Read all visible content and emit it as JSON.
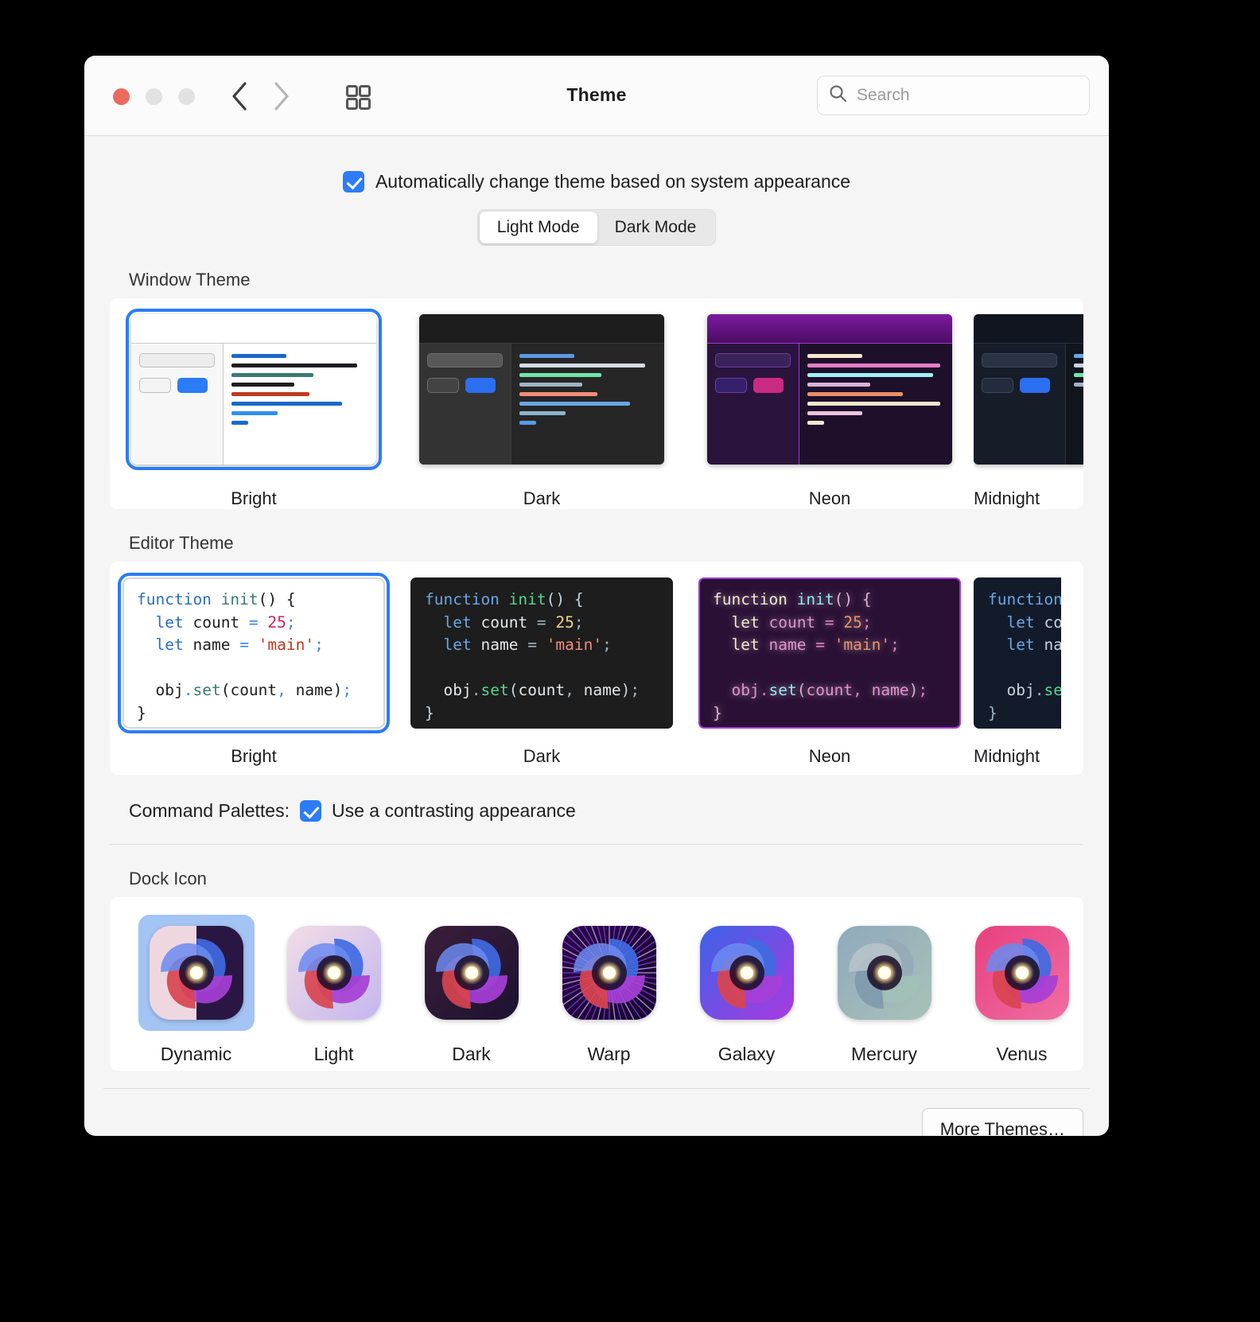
{
  "window": {
    "title": "Theme",
    "traffic_lights": [
      "close",
      "minimize",
      "zoom"
    ],
    "back_label": "Back",
    "forward_label": "Forward",
    "grid_label": "Show All",
    "accent_color": "#2b7cf6"
  },
  "search": {
    "placeholder": "Search",
    "value": ""
  },
  "auto_theme": {
    "label": "Automatically change theme based on system appearance",
    "checked": true
  },
  "appearance_segmented": {
    "options": [
      "Light Mode",
      "Dark Mode"
    ],
    "selected": "Light Mode"
  },
  "window_theme": {
    "heading": "Window Theme",
    "selected": "Bright",
    "items": [
      {
        "label": "Bright",
        "titlebar": "#ffffff",
        "sidebar": "#f7f7f7",
        "main": "#ffffff",
        "border": "#c9c9c9",
        "field_bg": "#ededed",
        "field_border": "#bdbdbd",
        "btn1_bg": "#f4f4f4",
        "btn2_bg": "#2b7cf6",
        "lines": [
          {
            "color": "#1a68c9",
            "width": "40%"
          },
          {
            "color": "#1d1d1f",
            "width": "92%"
          },
          {
            "color": "#3d7a74",
            "width": "60%"
          },
          {
            "color": "#1d1d1f",
            "width": "46%"
          },
          {
            "color": "#c03a1d",
            "width": "57%"
          },
          {
            "color": "#1a68c9",
            "width": "81%"
          },
          {
            "color": "#2f8ef0",
            "width": "34%"
          },
          {
            "color": "#1a68c9",
            "width": "12%"
          }
        ]
      },
      {
        "label": "Dark",
        "titlebar": "#1d1d1d",
        "sidebar": "#333333",
        "main": "#262626",
        "border": "#3a3a3a",
        "field_bg": "#585858",
        "field_border": "#6e6e6e",
        "btn1_bg": "#434343",
        "btn2_bg": "#2b6ef0",
        "lines": [
          {
            "color": "#5b9ae0",
            "width": "40%"
          },
          {
            "color": "#d4dde6",
            "width": "92%"
          },
          {
            "color": "#72e5a8",
            "width": "60%"
          },
          {
            "color": "#9fb4c6",
            "width": "46%"
          },
          {
            "color": "#f58b7a",
            "width": "57%"
          },
          {
            "color": "#6aa7e3",
            "width": "81%"
          },
          {
            "color": "#8fb3cc",
            "width": "34%"
          },
          {
            "color": "#5b9ae0",
            "width": "12%"
          }
        ]
      },
      {
        "label": "Neon",
        "titlebar": "#5c0f7a",
        "sidebar": "#2a133d",
        "main": "#1e0f2b",
        "border": "#a23bd4",
        "field_bg": "#3b2259",
        "field_border": "#6f3fa0",
        "btn1_bg": "#34206b",
        "btn2_bg": "#c92a82",
        "lines": [
          {
            "color": "#f6e8cd",
            "width": "40%"
          },
          {
            "color": "#e47dc4",
            "width": "97%"
          },
          {
            "color": "#9ff1f5",
            "width": "92%"
          },
          {
            "color": "#d9b3d9",
            "width": "46%"
          },
          {
            "color": "#ea9068",
            "width": "70%"
          },
          {
            "color": "#f6e8cd",
            "width": "97%"
          },
          {
            "color": "#edc3de",
            "width": "40%"
          },
          {
            "color": "#f6e8cd",
            "width": "12%"
          }
        ]
      },
      {
        "label": "Midnight",
        "titlebar": "#10151f",
        "sidebar": "#161c28",
        "main": "#0f141d",
        "border": "#273245",
        "field_bg": "#2a3345",
        "field_border": "#3a465c",
        "btn1_bg": "#232c3c",
        "btn2_bg": "#2b6ef0",
        "lines": [
          {
            "color": "#6aa7e3",
            "width": "40%"
          },
          {
            "color": "#c9d4e0",
            "width": "92%"
          },
          {
            "color": "#72e5a8",
            "width": "60%"
          },
          {
            "color": "#9fb4c6",
            "width": "46%"
          }
        ]
      }
    ]
  },
  "editor_theme": {
    "heading": "Editor Theme",
    "selected": "Bright",
    "code_lines": [
      "function init() {",
      "  let count = 25;",
      "  let name = 'main';",
      "",
      "  obj.set(count, name);",
      "}"
    ],
    "items": [
      {
        "label": "Bright",
        "bg": "#ffffff",
        "border": "#d6d6d6",
        "keyword": "#2b6ec2",
        "func": "#3d7a74",
        "text": "#1d1d1f",
        "number": "#d1265e",
        "string": "#c0391b",
        "operator": "#3b8ae0",
        "punct": "#1d1d1f",
        "glow": false
      },
      {
        "label": "Dark",
        "bg": "#1d1d1d",
        "border": "#1d1d1d",
        "keyword": "#6aa7e3",
        "func": "#55d48c",
        "text": "#e4e7ea",
        "number": "#f0d286",
        "string": "#f58b7a",
        "operator": "#9fb4c6",
        "punct": "#c9d4e0",
        "glow": false
      },
      {
        "label": "Neon",
        "bg": "#2a1034",
        "border": "#a23bd4",
        "keyword": "#f6e8cd",
        "func": "#8fe8ee",
        "text": "#e88fd0",
        "number": "#ef9266",
        "string": "#ef9266",
        "operator": "#e47dc4",
        "punct": "#d9b3d9",
        "glow": true
      },
      {
        "label": "Midnight",
        "bg": "#131b2a",
        "border": "#131b2a",
        "keyword": "#6aa7e3",
        "func": "#55d48c",
        "text": "#c9d4e0",
        "number": "#f0d286",
        "string": "#f58b7a",
        "operator": "#9fb4c6",
        "punct": "#9fb4c6",
        "glow": false
      }
    ]
  },
  "command_palettes": {
    "label": "Command Palettes:",
    "option_label": "Use a contrasting appearance",
    "checked": true
  },
  "dock_icon": {
    "heading": "Dock Icon",
    "selected": "Dynamic",
    "items": [
      {
        "label": "Dynamic",
        "bg_left": "#efd7e0",
        "bg_right": "#2a1642",
        "split": true
      },
      {
        "label": "Light",
        "bg_left": "#f2dde6",
        "bg_right": "#c3b6ef",
        "split": false
      },
      {
        "label": "Dark",
        "bg_left": "#3b1e3a",
        "bg_right": "#1c1230",
        "split": false
      },
      {
        "label": "Warp",
        "bg_left": "#2a0b4a",
        "bg_right": "#150530",
        "split": false,
        "rays": true
      },
      {
        "label": "Galaxy",
        "bg_left": "#3b63e8",
        "bg_right": "#a93ae0",
        "split": false
      },
      {
        "label": "Mercury",
        "bg_left": "#8fa9bc",
        "bg_right": "#a8c2b8",
        "split": false,
        "mono": true
      },
      {
        "label": "Venus",
        "bg_left": "#e8407f",
        "bg_right": "#f06ea2",
        "split": false
      }
    ]
  },
  "footer": {
    "more_themes_label": "More Themes…"
  }
}
